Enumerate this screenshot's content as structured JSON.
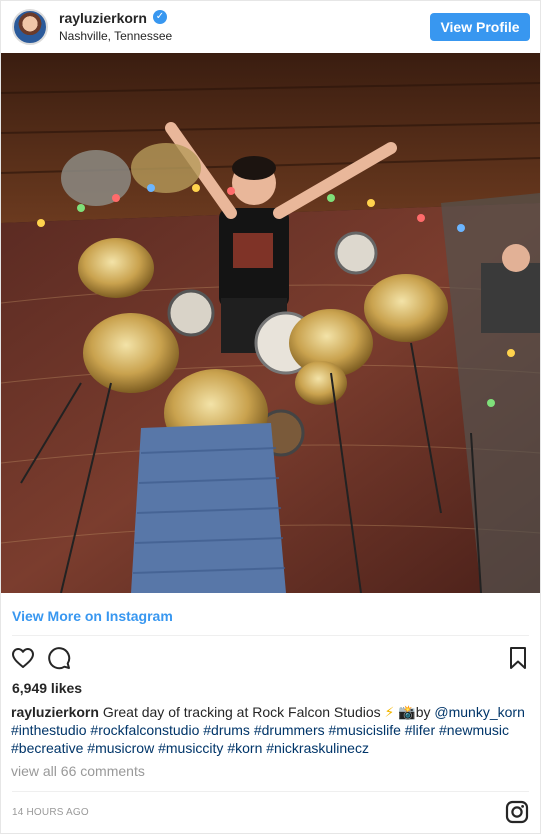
{
  "header": {
    "username": "rayluzierkorn",
    "verified_mark": "✓",
    "location": "Nashville, Tennessee",
    "view_profile_label": "View Profile"
  },
  "photo": {
    "icon": "photo"
  },
  "view_more_label": "View More on Instagram",
  "actions": {
    "like_icon": "heart-icon",
    "comment_icon": "comment-icon",
    "save_icon": "bookmark-icon"
  },
  "likes": "6,949 likes",
  "caption": {
    "username": "rayluzierkorn",
    "text_before": "Great day of tracking at Rock Falcon Studios",
    "bolt": "⚡",
    "camera": "📸",
    "by": "by",
    "mention": "@munky_korn",
    "hashtags": [
      "#inthestudio",
      "#rockfalconstudio",
      "#drums",
      "#drummers",
      "#musicislife",
      "#lifer",
      "#newmusic",
      "#becreative",
      "#musicrow",
      "#musiccity",
      "#korn",
      "#nickraskulinecz"
    ]
  },
  "comments_label": "view all 66 comments",
  "timestamp": "14 HOURS AGO",
  "colors": {
    "accent": "#3897f0",
    "link": "#003569",
    "muted": "#999999"
  }
}
